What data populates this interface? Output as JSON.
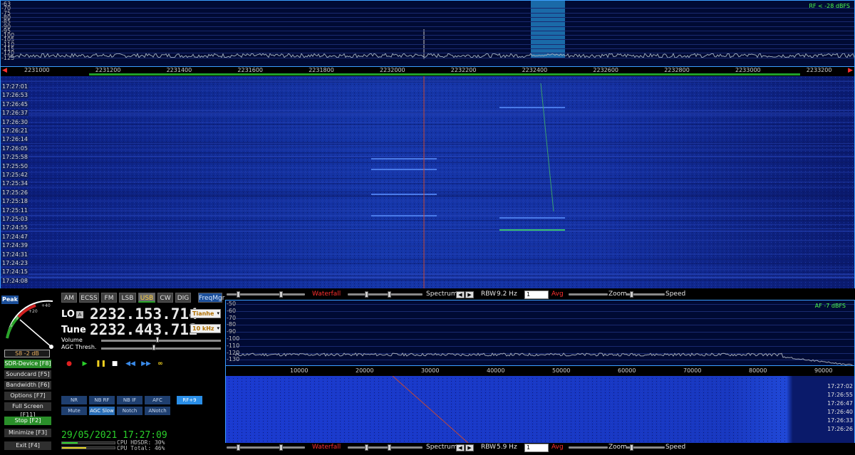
{
  "rf_spectrum": {
    "db_labels": [
      "-63",
      "-70",
      "-75",
      "-80",
      "-85",
      "-90",
      "-95",
      "-100",
      "-105",
      "-110",
      "-115",
      "-120",
      "-125"
    ],
    "status": "RF < -28 dBFS"
  },
  "rf_scale": {
    "ticks": [
      "2231000",
      "2231200",
      "2231400",
      "2231600",
      "2231800",
      "2232000",
      "2232200",
      "2232400",
      "2232600",
      "2232800",
      "2233000",
      "2233200"
    ]
  },
  "rf_waterfall": {
    "times": [
      "17:27:01",
      "17:26:53",
      "17:26:45",
      "17:26:37",
      "17:26:30",
      "17:26:21",
      "17:26:14",
      "17:26:05",
      "17:25:58",
      "17:25:50",
      "17:25:42",
      "17:25:34",
      "17:25:26",
      "17:25:18",
      "17:25:11",
      "17:25:03",
      "17:24:55",
      "17:24:47",
      "17:24:39",
      "17:24:31",
      "17:24:23",
      "17:24:15",
      "17:24:08"
    ]
  },
  "bar1": {
    "waterfall": "Waterfall",
    "spectrum": "Spectrum",
    "rbw_label": "RBW",
    "rbw_value": "9.2 Hz",
    "avg_value": "1",
    "avg": "Avg",
    "zoom": "Zoom",
    "speed": "Speed"
  },
  "left": {
    "peak": "Peak",
    "smeter_readout": "S8 -2 dB",
    "modes": [
      "AM",
      "ECSS",
      "FM",
      "LSB",
      "USB",
      "CW",
      "DIG"
    ],
    "freqmgr": "FreqMgr",
    "lo_label": "LO",
    "lo_a": "A",
    "lo_freq": "2232.153.714",
    "lo_select": "Tianhe",
    "tune_label": "Tune",
    "tune_freq": "2232.443.712",
    "tune_select": "10 kHz",
    "volume": "Volume",
    "agc": "AGC Thresh.",
    "side_buttons": [
      "SDR-Device [F8]",
      "Soundcard [F5]",
      "Bandwidth [F6]",
      "Options [F7]",
      "Full Screen [F11]",
      "Stop [F2]",
      "Minimize [F3]",
      "Exit [F4]"
    ],
    "dsp_row1": [
      "NR",
      "NB RF",
      "NB IF",
      "AFC"
    ],
    "rf_plus": "RF+9",
    "dsp_row2": [
      "Mute",
      "AGC Slow",
      "Notch",
      "ANotch"
    ],
    "datetime": "29/05/2021 17:27:09",
    "cpu_hdsdr": "CPU HDSDR: 30%",
    "cpu_total": "CPU Total: 46%",
    "cpu_hdsdr_pct": 30,
    "cpu_total_pct": 46
  },
  "af_spectrum": {
    "db_labels": [
      "-50",
      "-60",
      "-70",
      "-80",
      "-90",
      "-100",
      "-110",
      "-120",
      "-130"
    ],
    "status": "AF -7 dBFS"
  },
  "af_scale": {
    "ticks": [
      "10000",
      "20000",
      "30000",
      "40000",
      "50000",
      "60000",
      "70000",
      "80000",
      "90000"
    ]
  },
  "af_waterfall": {
    "times": [
      "17:27:02",
      "17:26:55",
      "17:26:47",
      "17:26:40",
      "17:26:33",
      "17:26:26"
    ]
  },
  "bar2": {
    "waterfall": "Waterfall",
    "spectrum": "Spectrum",
    "rbw_label": "RBW",
    "rbw_value": "5.9 Hz",
    "avg_value": "1",
    "avg": "Avg",
    "zoom": "Zoom",
    "speed": "Speed"
  },
  "colors": {
    "accent_blue": "#1b4f9a",
    "green": "#2a8f2a",
    "waterfall_base": "#0a1c7a"
  }
}
